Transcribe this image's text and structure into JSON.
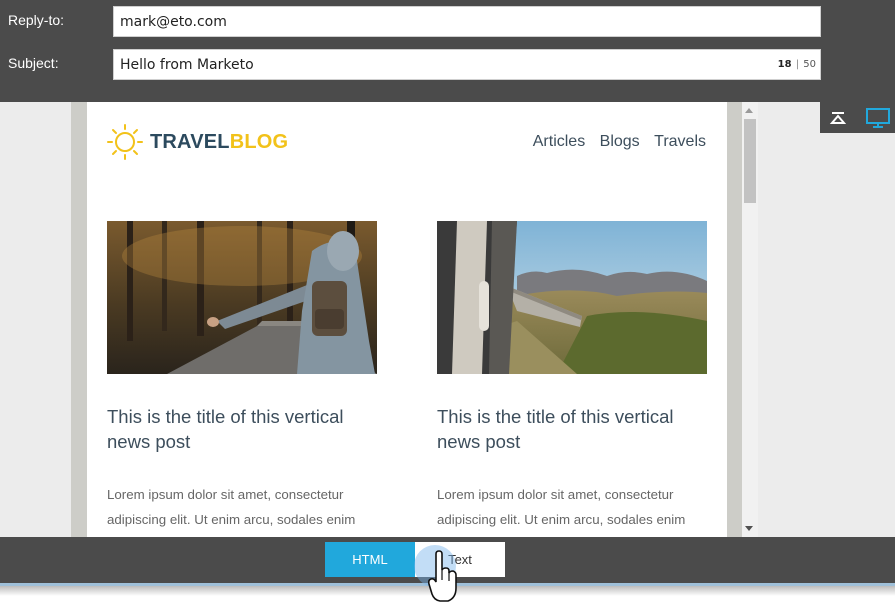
{
  "header": {
    "reply_to": {
      "label": "Reply-to:",
      "value": "mark@eto.com"
    },
    "subject": {
      "label": "Subject:",
      "value": "Hello from Marketo",
      "char_count": "18",
      "char_limit": "50"
    }
  },
  "toolbar": {
    "icons": [
      "scroll-to-top-icon",
      "desktop-icon"
    ],
    "active_icon_color": "#21a8dc"
  },
  "email": {
    "logo": {
      "word1": "TRAVEL",
      "word2": "BLOG",
      "color1": "#2c4a5e",
      "color2": "#f2c21a"
    },
    "nav": [
      "Articles",
      "Blogs",
      "Travels"
    ],
    "posts": [
      {
        "title": "This is the title of this vertical news post",
        "body": "Lorem ipsum dolor sit amet, consectetur adipiscing elit. Ut enim arcu, sodales enim",
        "image": "hitchhiker-photo"
      },
      {
        "title": "This is the title of this vertical news post",
        "body": "Lorem ipsum dolor sit amet, consectetur adipiscing elit. Ut enim arcu, sodales enim",
        "image": "train-photo"
      }
    ]
  },
  "view_toggle": {
    "html_label": "HTML",
    "text_label": "Text",
    "active": "HTML",
    "accent": "#21a8dc"
  }
}
